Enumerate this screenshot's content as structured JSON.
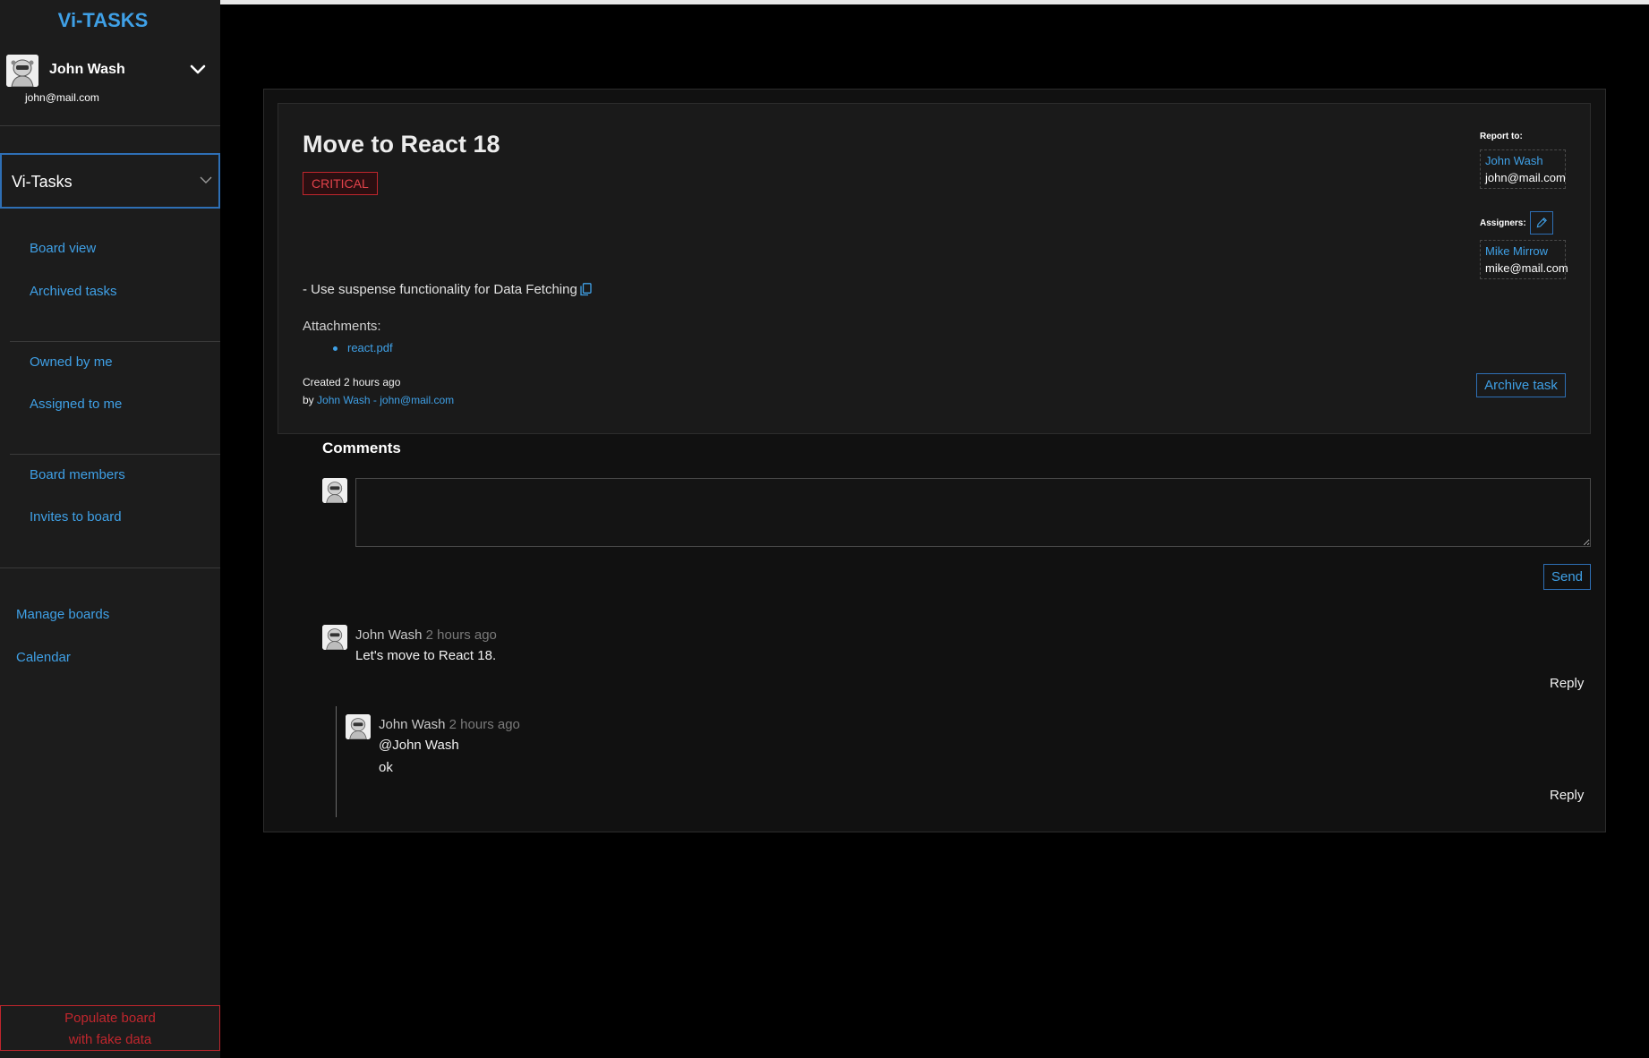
{
  "sidebar": {
    "brand": "Vi-TASKS",
    "user": {
      "name": "John Wash",
      "email": "john@mail.com"
    },
    "board_select": {
      "value": "Vi-Tasks"
    },
    "nav": {
      "board_view": "Board view",
      "archived_tasks": "Archived tasks",
      "owned_by_me": "Owned by me",
      "assigned_to_me": "Assigned to me",
      "board_members": "Board members",
      "invites_to_board": "Invites to board",
      "manage_boards": "Manage boards",
      "calendar": "Calendar"
    },
    "populate_line1": "Populate board",
    "populate_line2": "with fake data"
  },
  "task": {
    "title": "Move to React 18",
    "priority": "CRITICAL",
    "description": "- Use suspense functionality for Data Fetching",
    "attachments_label": "Attachments:",
    "attachments": [
      "react.pdf"
    ],
    "created": "Created 2 hours ago",
    "by_prefix": "by ",
    "by_author": "John Wash - john@mail.com",
    "report_to_label": "Report to:",
    "report_to": {
      "name": "John Wash",
      "email": "john@mail.com"
    },
    "assigners_label": "Assigners:",
    "assigners": [
      {
        "name": "Mike Mirrow",
        "email": "mike@mail.com"
      }
    ],
    "archive_label": "Archive task"
  },
  "comments": {
    "title": "Comments",
    "input_value": "",
    "send_label": "Send",
    "items": [
      {
        "author": "John Wash",
        "time": "2 hours ago",
        "text": "Let's move to React 18.",
        "reply_label": "Reply"
      }
    ],
    "replies": [
      {
        "author": "John Wash",
        "time": "2 hours ago",
        "line1": "@John Wash",
        "line2": "ok",
        "reply_label": "Reply"
      }
    ]
  },
  "icons": {
    "user_menu": "chevron-down-icon",
    "board_dropdown": "chevron-down-icon",
    "copy": "copy-icon",
    "edit": "pencil-icon",
    "avatar": "robot-avatar-icon"
  },
  "colors": {
    "accent": "#3fa0e6",
    "danger": "#c0262d",
    "sidebar_bg": "#1c1c1c",
    "card_bg": "#1a1a1a"
  }
}
